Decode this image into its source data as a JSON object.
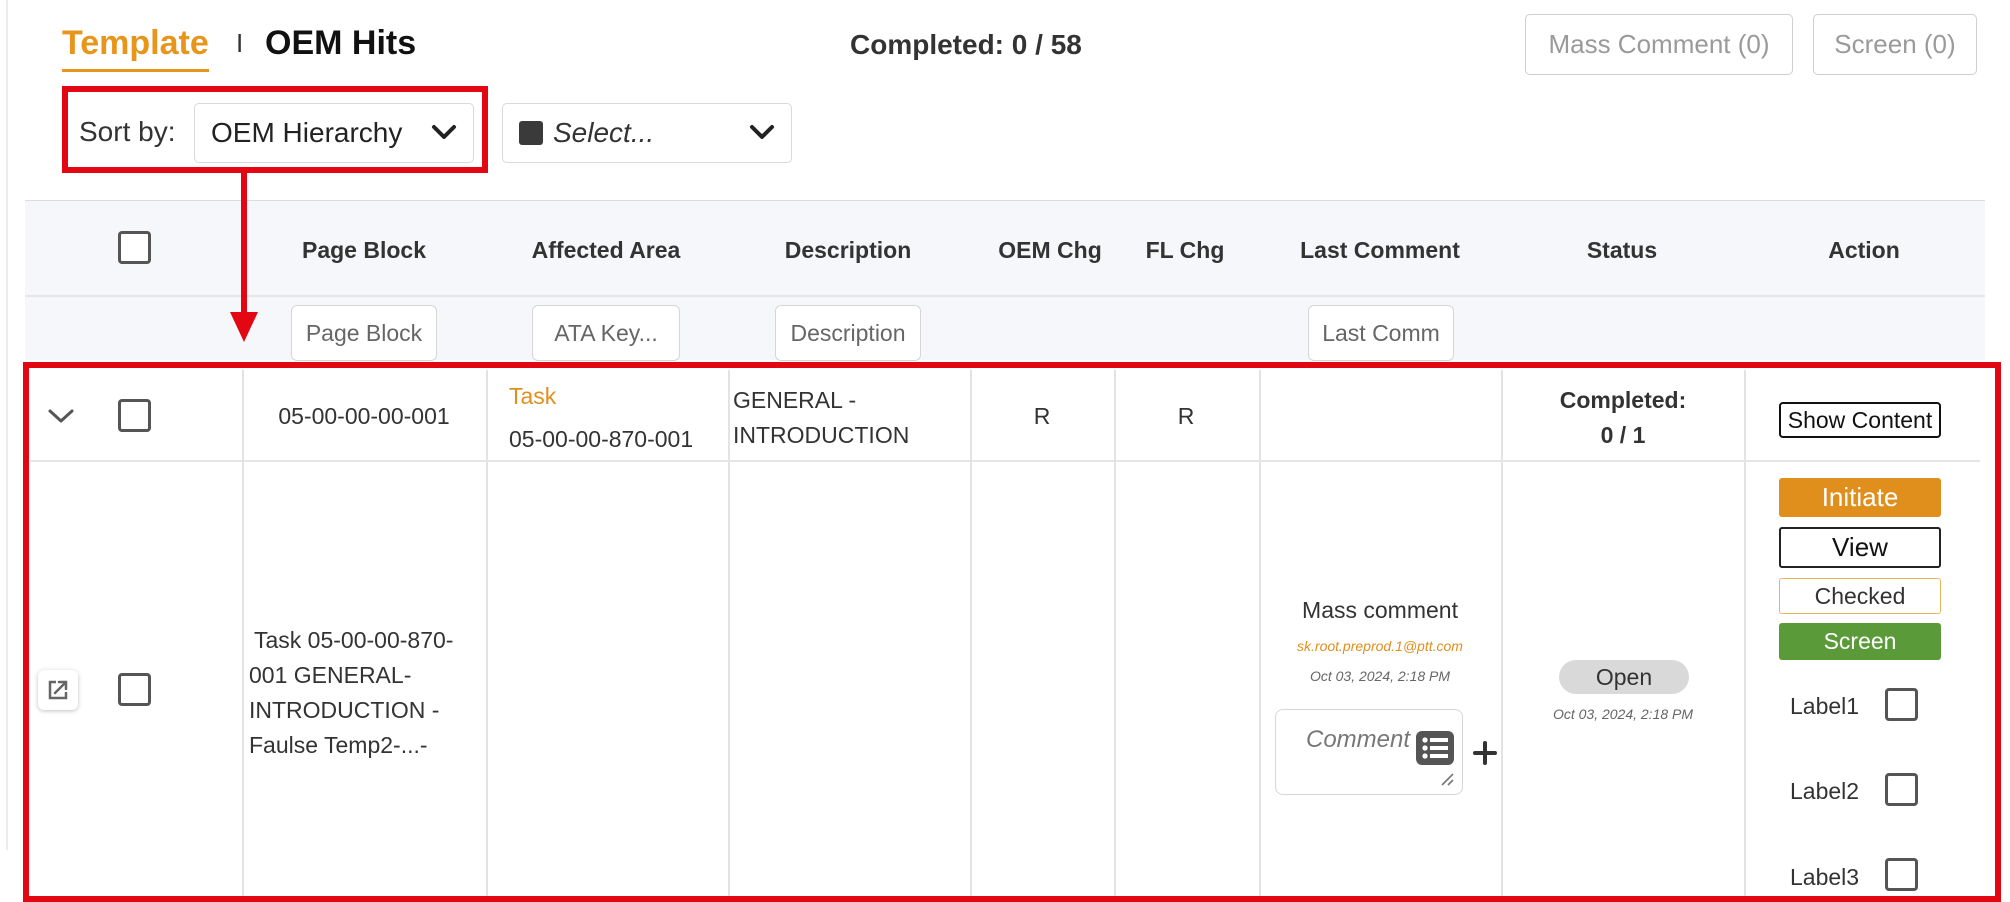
{
  "header": {
    "tab_template": "Template",
    "tab_separator": "I",
    "tab_oem_hits": "OEM Hits",
    "completed_text": "Completed: 0 / 58",
    "mass_comment_button": "Mass Comment (0)",
    "screen_button": "Screen (0)"
  },
  "sort": {
    "label": "Sort by:",
    "selected": "OEM Hierarchy",
    "filter_placeholder": "Select..."
  },
  "table": {
    "columns": [
      "Page Block",
      "Affected Area",
      "Description",
      "OEM Chg",
      "FL Chg",
      "Last Comment",
      "Status",
      "Action"
    ],
    "filters": {
      "page_block": "Page Block",
      "affected_area": "ATA Key...",
      "description": "Description",
      "last_comment": "Last Comm"
    },
    "group_row": {
      "page_block": "05-00-00-00-001",
      "affected_area_label": "Task",
      "affected_area_value": "05-00-00-870-001",
      "description_line1": "GENERAL -",
      "description_line2": "INTRODUCTION",
      "oem_chg": "R",
      "fl_chg": "R",
      "status_label": "Completed:",
      "status_value": "0 / 1",
      "action_button": "Show Content"
    },
    "task_row": {
      "page_block_lines": [
        "Task 05-00-00-870-",
        "001 GENERAL-",
        "INTRODUCTION -",
        "Faulse Temp2-...-"
      ],
      "last_comment_title": "Mass comment",
      "last_comment_author": "sk.root.preprod.1@ptt.com",
      "last_comment_date": "Oct 03, 2024, 2:18 PM",
      "comment_placeholder": "Comment",
      "status": "Open",
      "status_date": "Oct 03, 2024, 2:18 PM",
      "actions": {
        "initiate": "Initiate",
        "view": "View",
        "checked": "Checked",
        "screen": "Screen"
      },
      "labels": [
        "Label1",
        "Label2",
        "Label3"
      ]
    }
  },
  "colors": {
    "accent": "#e8951c",
    "annotation": "#e30613",
    "screen_green": "#5a9a38"
  }
}
